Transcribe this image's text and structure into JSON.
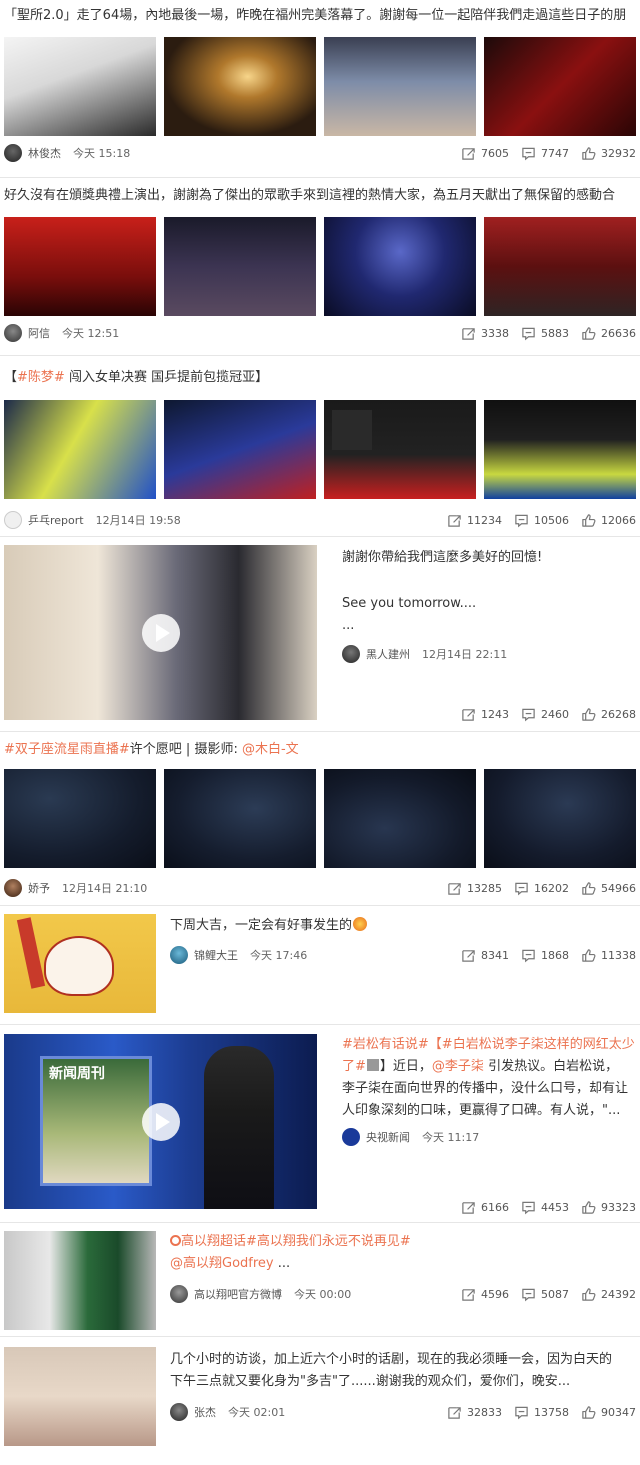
{
  "posts": [
    {
      "title": "「聖所2.0」走了64場，內地最後一場，昨晚在福州完美落幕了。謝謝每一位一起陪伴我們走過這些日子的朋",
      "author": "林俊杰",
      "time": "今天 15:18",
      "reposts": "7605",
      "comments": "7747",
      "likes": "32932"
    },
    {
      "title": "好久沒有在頒獎典禮上演出，謝謝為了傑出的眾歌手來到這裡的熱情大家，為五月天獻出了無保留的感動合",
      "author": "阿信",
      "time": "今天 12:51",
      "reposts": "3338",
      "comments": "5883",
      "likes": "26636"
    },
    {
      "title_prefix": "【",
      "title_tag": "#陈梦#",
      "title_rest": " 闯入女单决赛 国乒提前包揽冠亚】",
      "author": "乒乓report",
      "time": "12月14日 19:58",
      "reposts": "11234",
      "comments": "10506",
      "likes": "12066"
    },
    {
      "text1": "謝謝你帶給我們這麼多美好的回憶!",
      "text2": "See you tomorrow....",
      "text3": "...",
      "author": "黑人建州",
      "time": "12月14日 22:11",
      "reposts": "1243",
      "comments": "2460",
      "likes": "26268"
    },
    {
      "title_tag": "#双子座流星雨直播#",
      "title_mid": "许个愿吧 | 摄影师: ",
      "title_mention": "@木白-文",
      "author": "娇予",
      "time": "12月14日 21:10",
      "reposts": "13285",
      "comments": "16202",
      "likes": "54966"
    },
    {
      "text": "下周大吉，一定会有好事发生的",
      "author": "锦鲤大王",
      "time": "今天 17:46",
      "reposts": "8341",
      "comments": "1868",
      "likes": "11338"
    },
    {
      "tag1": "#岩松有话说#",
      "tag2": "【#白岩松说李子柒这样的网红太少了#",
      "line2_rest": "】近日，",
      "mention": "@李子柒",
      "line2_end": " 引发热议。白岩松说，",
      "line3": "李子柒在面向世界的传播中，没什么口号，却有让",
      "line4": "人印象深刻的口味，更赢得了口碑。有人说，\"...",
      "author": "央视新闻",
      "time": "今天 11:17",
      "thumb_caption": "新闻周刊",
      "reposts": "6166",
      "comments": "4453",
      "likes": "93323"
    },
    {
      "tags": "高以翔超话#高以翔我们永远不说再见#",
      "mention": "@高以翔Godfrey",
      "mention_rest": " ...",
      "author": "高以翔吧官方微博",
      "time": "今天 00:00",
      "reposts": "4596",
      "comments": "5087",
      "likes": "24392"
    },
    {
      "line1": "几个小时的访谈，加上近六个小时的话剧，现在的我必须睡一会，因为白天的",
      "line2": "下午三点就又要化身为\"多吉\"了......谢谢我的观众们，爱你们，晚安...",
      "author": "张杰",
      "time": "今天 02:01",
      "reposts": "32833",
      "comments": "13758",
      "likes": "90347"
    }
  ],
  "colors": {
    "link": "#eb7350",
    "text": "#333333",
    "meta": "#666666"
  }
}
